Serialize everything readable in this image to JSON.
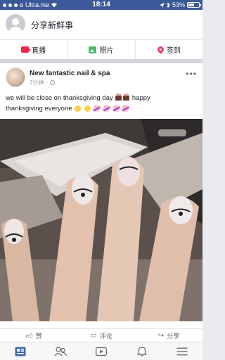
{
  "status_bar": {
    "carrier": "Ultra.me",
    "time": "18:14",
    "battery": "53%"
  },
  "composer": {
    "prompt": "分享新鲜事",
    "actions": [
      {
        "label": "直播",
        "icon": "live-video-icon",
        "color": "#f02849"
      },
      {
        "label": "照片",
        "icon": "photo-icon",
        "color": "#45bd62"
      },
      {
        "label": "签到",
        "icon": "check-in-pin-icon",
        "color": "#e4405f"
      }
    ]
  },
  "post": {
    "author": "New fantastic nail & spa",
    "time": "2分钟",
    "privacy_icon": "globe-icon",
    "text_part1": "we will be close on thanksgiving day",
    "text_part2": "happy",
    "text_part3": "thanksgiving everyone",
    "photo_description_icon": "nail-art-photo"
  },
  "post_actions": [
    {
      "label": "赞",
      "icon": "like-icon"
    },
    {
      "label": "评论",
      "icon": "comment-icon"
    },
    {
      "label": "分享",
      "icon": "share-icon"
    }
  ],
  "tabbar": [
    {
      "icon": "news-feed-icon",
      "active": true
    },
    {
      "icon": "friends-icon",
      "active": false
    },
    {
      "icon": "watch-video-icon",
      "active": false
    },
    {
      "icon": "notifications-bell-icon",
      "active": false
    },
    {
      "icon": "menu-icon",
      "active": false
    }
  ],
  "colors": {
    "brand": "#3b5998",
    "active_tab": "#4267b2",
    "inactive_tab": "#606770"
  }
}
